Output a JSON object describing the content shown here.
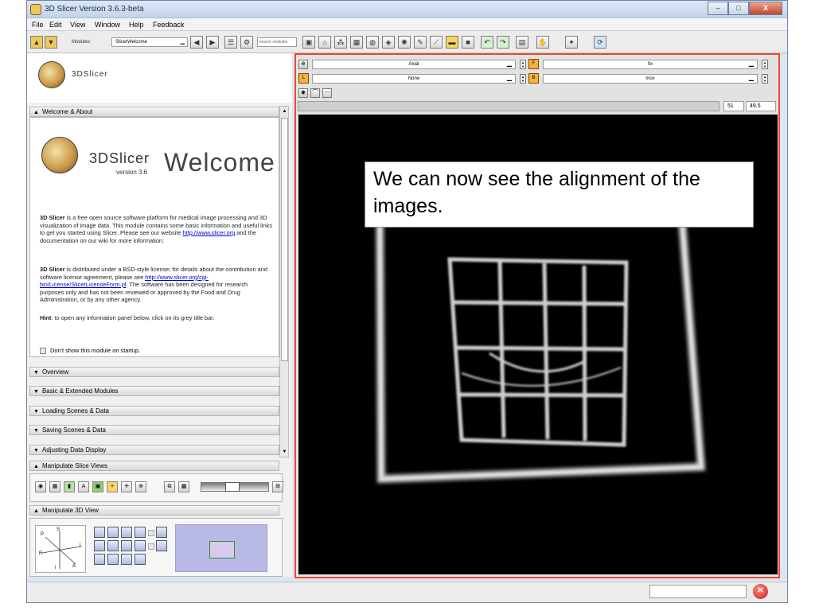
{
  "window": {
    "title": "3D Slicer Version 3.6.3-beta",
    "minimize_glyph": "–",
    "maximize_glyph": "□",
    "close_glyph": "X"
  },
  "menu": {
    "items": [
      "File",
      "Edit",
      "View",
      "Window",
      "Help",
      "Feedback"
    ]
  },
  "toolbar": {
    "modules_label": "Modules:",
    "module_selected": "SlicerWelcome",
    "search_placeholder": "search modules"
  },
  "sidebar": {
    "logo_text": "3DSlicer",
    "sections": {
      "welcome_about": "Welcome & About",
      "overview": "Overview",
      "basic_modules": "Basic & Extended Modules",
      "loading": "Loading Scenes & Data",
      "saving": "Saving Scenes & Data",
      "adjusting": "Adjusting Data Display",
      "manipulate_slice": "Manipulate Slice Views",
      "manipulate_3d": "Manipulate 3D View"
    }
  },
  "welcome": {
    "logo_text": "3DSlicer",
    "version": "version 3.6",
    "welcome_word": "Welcome",
    "p1_bold": "3D Slicer",
    "p1_text": " is a free open source software platform for medical image processing and 3D visualization of image data. This module contains some basic information and useful links to get you started using Slicer. Please see our website ",
    "p1_link": "http://www.slicer.org",
    "p1_tail": " and the documentation on our wiki for more information:",
    "p2_bold": "3D Slicer",
    "p2_text": " is distributed under a BSD-style license; for details about the contribution and software license agreement, please see ",
    "p2_link": "http://www.slicer.org/cgi-bin/License/SlicerLicenseForm.pl",
    "p2_tail": ". The software has been designed for research purposes only and has not been reviewed or approved by the Food and Drug Administration, or by any other agency.",
    "hint_bold": "Hint",
    "hint_text": ": to open any information panel below, click on its grey title bar.",
    "dont_show": "Don't show this module on startup."
  },
  "axis_labels": {
    "P": "P",
    "S": "S",
    "R": "R",
    "L": "L",
    "I": "I",
    "A": "A"
  },
  "slice_controls": {
    "orientation": "Axial",
    "label_layer": "None",
    "foreground": "fix",
    "background": "mov",
    "slice_index": "51",
    "slice_offset": "49.5"
  },
  "callout": {
    "text": "We can now see the alignment of the images."
  },
  "colors": {
    "highlight_border": "#e84a2f",
    "viewer_background": "#000000",
    "link": "#0000cc"
  }
}
